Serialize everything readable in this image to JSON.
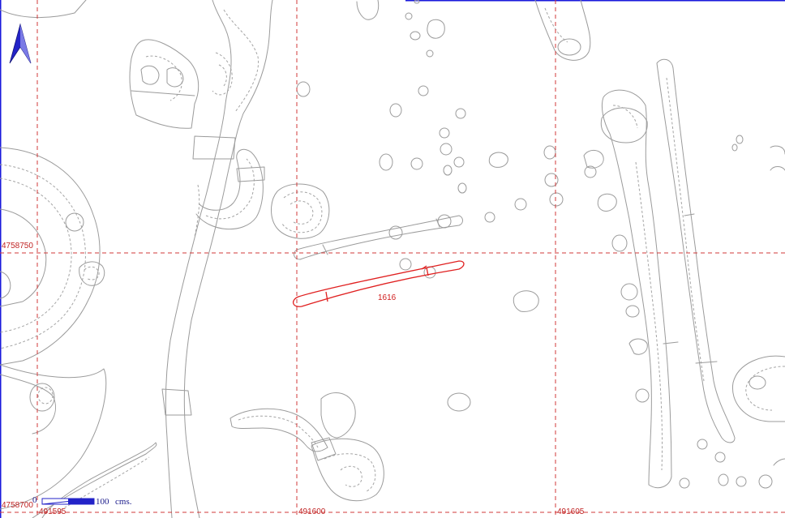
{
  "map": {
    "north_arrow_icon": "north-arrow-icon",
    "grid_labels": {
      "y_4758750": "4758750",
      "y_4758700": "4758700",
      "x_491595": "491595",
      "x_491600": "491600",
      "x_491605": "491605"
    },
    "highlighted_feature": {
      "label": "1616"
    },
    "scale_bar": {
      "start": "0",
      "end": "100",
      "unit": "cms."
    },
    "colors": {
      "grid": "#d23a3a",
      "highlight": "#e02020",
      "features": "#9b9b9b",
      "frame": "#1a1adc"
    }
  }
}
